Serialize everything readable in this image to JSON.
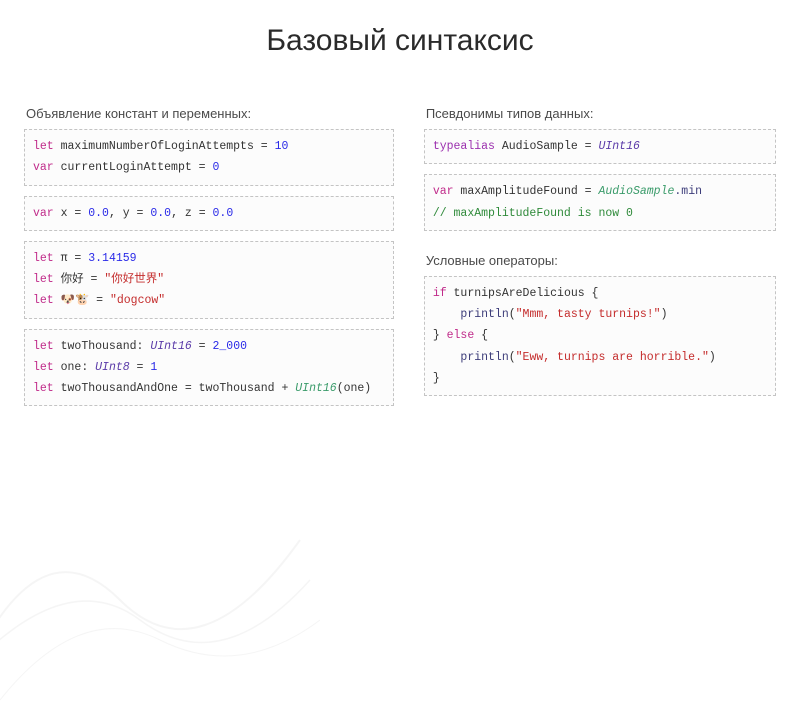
{
  "title": "Базовый синтаксис",
  "left": {
    "heading": "Объявление констант и переменных:",
    "box1": {
      "l1_kw": "let",
      "l1_id": "maximumNumberOfLoginAttempts",
      "l1_eq": " = ",
      "l1_val": "10",
      "l2_kw": "var",
      "l2_id": "currentLoginAttempt",
      "l2_eq": " = ",
      "l2_val": "0"
    },
    "box2": {
      "kw": "var",
      "rest_a": " x = ",
      "v1": "0.0",
      "c1": ", y = ",
      "v2": "0.0",
      "c2": ", z = ",
      "v3": "0.0"
    },
    "box3": {
      "l1_kw": "let",
      "l1_id": " π = ",
      "l1_val": "3.14159",
      "l2_kw": "let",
      "l2_id": " 你好 = ",
      "l2_val": "\"你好世界\"",
      "l3_kw": "let",
      "l3_id": " 🐶🐮 = ",
      "l3_val": "\"dogcow\""
    },
    "box4": {
      "l1_kw": "let",
      "l1_id": " twoThousand: ",
      "l1_type": "UInt16",
      "l1_eq": " = ",
      "l1_val": "2_000",
      "l2_kw": "let",
      "l2_id": " one: ",
      "l2_type": "UInt8",
      "l2_eq": " = ",
      "l2_val": "1",
      "l3_kw": "let",
      "l3_id": " twoThousandAndOne = twoThousand + ",
      "l3_type": "UInt16",
      "l3_call": "(one)"
    }
  },
  "right": {
    "heading1": "Псевдонимы типов данных:",
    "box1": {
      "kw": "typealias",
      "name": " AudioSample = ",
      "type": "UInt16"
    },
    "box2": {
      "l1_kw": "var",
      "l1_id": " maxAmplitudeFound = ",
      "l1_type": "AudioSample",
      "l1_prop": ".min",
      "l2_cmt": "// maxAmplitudeFound is now 0"
    },
    "heading2": "Условные операторы:",
    "box3": {
      "l1_kw": "if",
      "l1_cond": " turnipsAreDelicious {",
      "l2_pad": "    ",
      "l2_fn": "println",
      "l2_open": "(",
      "l2_str": "\"Mmm, tasty turnips!\"",
      "l2_close": ")",
      "l3_a": "} ",
      "l3_kw": "else",
      "l3_b": " {",
      "l4_pad": "    ",
      "l4_fn": "println",
      "l4_open": "(",
      "l4_str": "\"Eww, turnips are horrible.\"",
      "l4_close": ")",
      "l5": "}"
    }
  }
}
